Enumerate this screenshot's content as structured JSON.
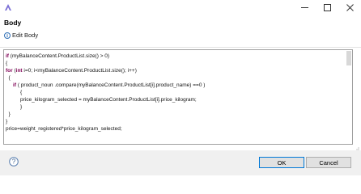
{
  "titlebar": {
    "app_icon": "eclipse-app-icon",
    "buttons": [
      "minimize-icon",
      "maximize-icon",
      "close-icon"
    ]
  },
  "dialog": {
    "title": "Body",
    "message_icon": "info-icon",
    "message": "Edit Body"
  },
  "editor": {
    "lines": [
      [
        {
          "t": "if",
          "kw": true
        },
        {
          "t": " (myBalanceContent.ProductList.size() > 0)"
        }
      ],
      [
        {
          "t": "{"
        }
      ],
      [
        {
          "t": "for",
          "kw": true
        },
        {
          "t": " ("
        },
        {
          "t": "int",
          "kw": true
        },
        {
          "t": " i=0; i<myBalanceContent.ProductList.size(); i++)"
        }
      ],
      [
        {
          "t": "  {"
        }
      ],
      [
        {
          "t": "     "
        },
        {
          "t": "if",
          "kw": true
        },
        {
          "t": " ( product_noun .compare(myBalanceContent.ProductList[i].product_name) ==0 )"
        }
      ],
      [
        {
          "t": "          {"
        }
      ],
      [
        {
          "t": "          price_kilogram_selected = myBalanceContent.ProductList[i].price_kilogram;"
        }
      ],
      [
        {
          "t": "          }"
        }
      ],
      [
        {
          "t": "  }"
        }
      ],
      [
        {
          "t": "}"
        }
      ],
      [
        {
          "t": "price=weight_registered*price_kilogram_selected;"
        }
      ]
    ]
  },
  "footer": {
    "help_icon": "help-icon",
    "ok_label": "OK",
    "cancel_label": "Cancel"
  },
  "colors": {
    "keyword": "#7f0055",
    "ok_border": "#0078d7",
    "footer_bg": "#f0f0f0"
  }
}
